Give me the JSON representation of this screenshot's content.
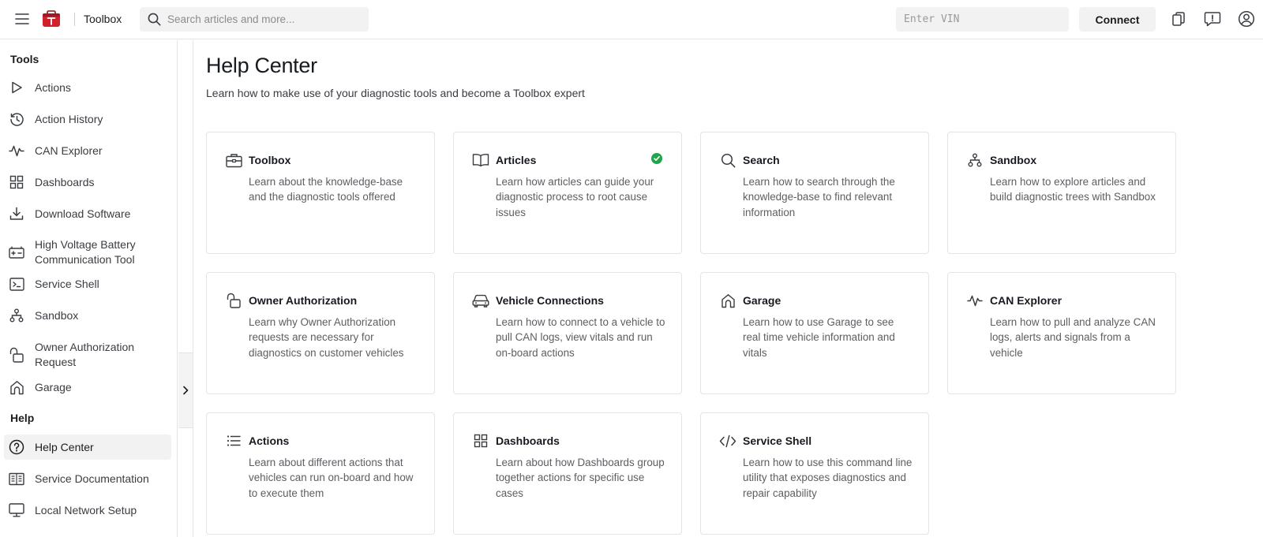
{
  "app": {
    "name": "Toolbox",
    "brand_color": "#d0202c"
  },
  "topbar": {
    "search_placeholder": "Search articles and more...",
    "vin_placeholder": "Enter VIN",
    "connect_label": "Connect",
    "icons": [
      "copy-icon",
      "feedback-icon",
      "account-icon"
    ]
  },
  "sidebar": {
    "tools_label": "Tools",
    "help_label": "Help",
    "tools": [
      {
        "label": "Actions",
        "icon": "play-icon"
      },
      {
        "label": "Action History",
        "icon": "history-icon"
      },
      {
        "label": "CAN Explorer",
        "icon": "waveform-icon"
      },
      {
        "label": "Dashboards",
        "icon": "grid-icon"
      },
      {
        "label": "Download Software",
        "icon": "download-icon"
      },
      {
        "label": "High Voltage Battery\nCommunication Tool",
        "icon": "battery-icon"
      },
      {
        "label": "Service Shell",
        "icon": "terminal-icon"
      },
      {
        "label": "Sandbox",
        "icon": "hierarchy-icon"
      },
      {
        "label": "Owner Authorization\nRequest",
        "icon": "unlock-icon"
      },
      {
        "label": "Garage",
        "icon": "home-icon"
      }
    ],
    "help": [
      {
        "label": "Help Center",
        "icon": "question-icon",
        "active": true
      },
      {
        "label": "Service Documentation",
        "icon": "book-icon"
      },
      {
        "label": "Local Network Setup",
        "icon": "monitor-icon"
      }
    ]
  },
  "main": {
    "title": "Help Center",
    "subtitle": "Learn how to make use of your diagnostic tools and become a Toolbox expert",
    "cards": [
      {
        "title": "Toolbox",
        "icon": "toolbox-icon",
        "desc": "Learn about the knowledge-base and the diagnostic tools offered"
      },
      {
        "title": "Articles",
        "icon": "open-book-icon",
        "desc": "Learn how articles can guide your diagnostic process to root cause issues",
        "completed": true
      },
      {
        "title": "Search",
        "icon": "search-icon",
        "desc": "Learn how to search through the knowledge-base to find relevant information"
      },
      {
        "title": "Sandbox",
        "icon": "hierarchy-icon",
        "desc": "Learn how to explore articles and build diagnostic trees with Sandbox"
      },
      {
        "title": "Owner Authorization",
        "icon": "unlock-icon",
        "desc": "Learn why Owner Authorization requests are necessary for diagnostics on customer vehicles"
      },
      {
        "title": "Vehicle Connections",
        "icon": "car-icon",
        "desc": "Learn how to connect to a vehicle to pull CAN logs, view vitals and run on-board actions"
      },
      {
        "title": "Garage",
        "icon": "home-icon",
        "desc": "Learn how to use Garage to see real time vehicle information and vitals"
      },
      {
        "title": "CAN Explorer",
        "icon": "waveform-icon",
        "desc": "Learn how to pull and analyze CAN logs, alerts and signals from a vehicle"
      },
      {
        "title": "Actions",
        "icon": "list-icon",
        "desc": "Learn about different actions that vehicles can run on-board and how to execute them"
      },
      {
        "title": "Dashboards",
        "icon": "grid-icon",
        "desc": "Learn about how Dashboards group together actions for specific use cases"
      },
      {
        "title": "Service Shell",
        "icon": "code-icon",
        "desc": "Learn how to use this command line utility that exposes diagnostics and repair capability"
      }
    ]
  },
  "colors": {
    "border": "#e4e4e6",
    "active_bg": "#f2f2f3",
    "check_green": "#1fa64a",
    "text_primary": "#171a20",
    "text_secondary": "#5c5e62"
  }
}
